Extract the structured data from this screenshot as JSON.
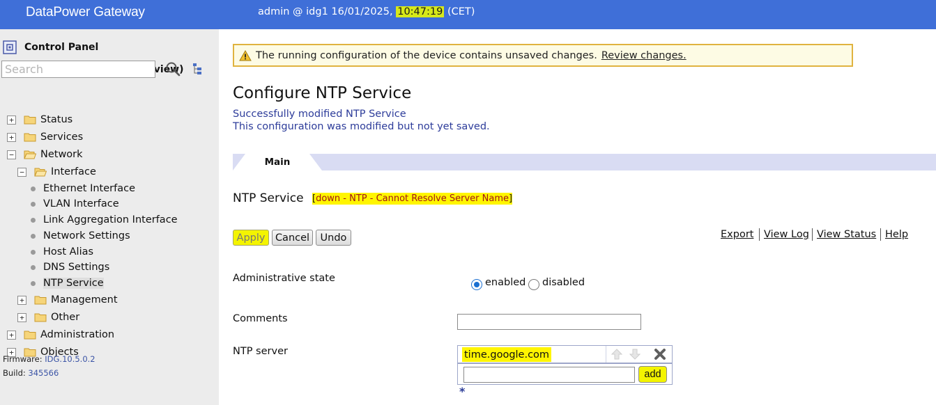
{
  "header": {
    "brand": "DataPower Gateway",
    "session_prefix": "admin @ idg1 16/01/2025, ",
    "time": "10:47:19",
    "timezone": " (CET)"
  },
  "sidebar": {
    "control_panel": "Control Panel",
    "new_ui": "New UI (technology preview)",
    "search_placeholder": "Search",
    "tree": {
      "status": "Status",
      "services": "Services",
      "network": "Network",
      "interface": "Interface",
      "interface_items": [
        "Ethernet Interface",
        "VLAN Interface",
        "Link Aggregation Interface"
      ],
      "network_items": [
        "Network Settings",
        "Host Alias",
        "DNS Settings",
        "NTP Service"
      ],
      "management": "Management",
      "other": "Other",
      "administration": "Administration",
      "objects": "Objects"
    },
    "firmware_label": "Firmware:",
    "firmware_value": "IDG.10.5.0.2",
    "build_label": "Build:",
    "build_value": "345566"
  },
  "main": {
    "warning_text": "The running configuration of the device contains unsaved changes.",
    "warning_link": "Review changes.",
    "title": "Configure NTP Service",
    "msg_success": "Successfully modified NTP Service",
    "msg_unsaved": "This configuration was modified but not yet saved.",
    "tab_main": "Main",
    "object_name": "NTP Service",
    "object_status_open": "[",
    "object_status": "down - NTP - Cannot Resolve Server Name",
    "object_status_close": "]",
    "buttons": {
      "apply": "Apply",
      "cancel": "Cancel",
      "undo": "Undo"
    },
    "links": {
      "export": "Export",
      "view_log": "View Log",
      "view_status": "View Status",
      "help": "Help"
    },
    "fields": {
      "admin_state_label": "Administrative state",
      "enabled": "enabled",
      "disabled": "disabled",
      "admin_state_value": "enabled",
      "comments_label": "Comments",
      "comments_value": "",
      "ntp_server_label": "NTP server",
      "ntp_servers": [
        "time.google.com"
      ],
      "add_label": "add",
      "required_mark": "*"
    }
  },
  "colors": {
    "header_bg": "#3f6fd8",
    "highlight": "#fff500",
    "message_blue": "#2d3c9a",
    "warning_border": "#e0b33f"
  }
}
